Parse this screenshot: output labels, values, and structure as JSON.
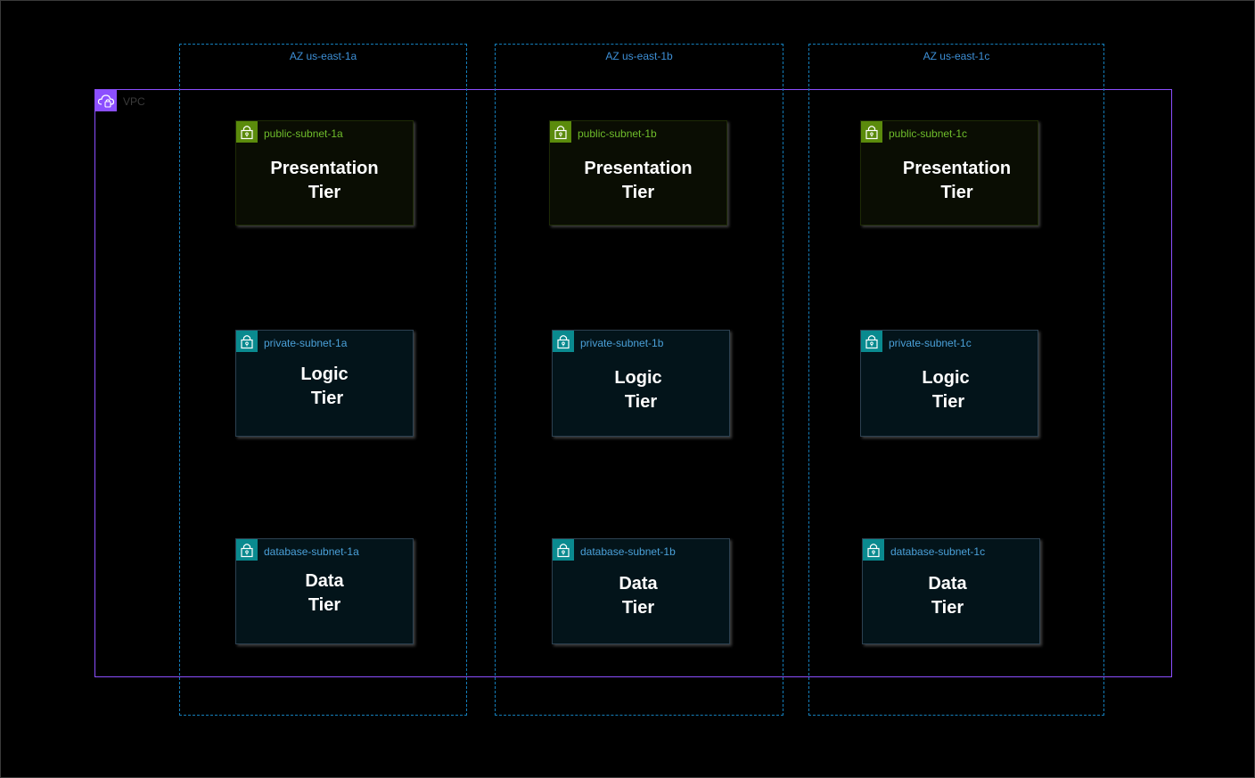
{
  "vpc": {
    "label": "VPC",
    "icon": "vpc-cloud-icon",
    "color": "#8c4fff"
  },
  "azs": [
    {
      "label": "AZ us-east-1a"
    },
    {
      "label": "AZ us-east-1b"
    },
    {
      "label": "AZ us-east-1c"
    }
  ],
  "subnets": [
    {
      "label": "public-subnet-1a",
      "tier_line1": "Presentation",
      "tier_line2": "Tier"
    },
    {
      "label": "public-subnet-1b",
      "tier_line1": "Presentation",
      "tier_line2": "Tier"
    },
    {
      "label": "public-subnet-1c",
      "tier_line1": "Presentation",
      "tier_line2": "Tier"
    },
    {
      "label": "private-subnet-1a",
      "tier_line1": "Logic",
      "tier_line2": "Tier"
    },
    {
      "label": "private-subnet-1b",
      "tier_line1": "Logic",
      "tier_line2": "Tier"
    },
    {
      "label": "private-subnet-1c",
      "tier_line1": "Logic",
      "tier_line2": "Tier"
    },
    {
      "label": "database-subnet-1a",
      "tier_line1": "Data",
      "tier_line2": "Tier"
    },
    {
      "label": "database-subnet-1b",
      "tier_line1": "Data",
      "tier_line2": "Tier"
    },
    {
      "label": "database-subnet-1c",
      "tier_line1": "Data",
      "tier_line2": "Tier"
    }
  ],
  "colors": {
    "public_subnet": "#5b8b0c",
    "private_subnet": "#0a8a8f",
    "az_border": "#147eba"
  },
  "subnet_icon": "lock-icon"
}
